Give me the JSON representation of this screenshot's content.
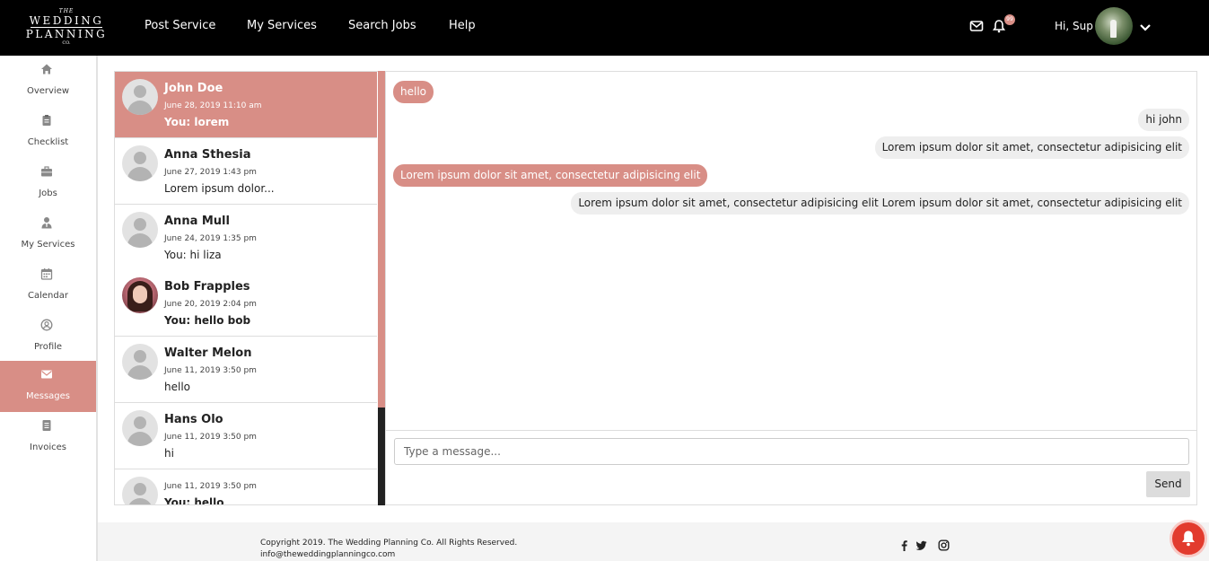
{
  "brand": {
    "the": "THE",
    "line1": "WEDDING",
    "line2": "PLANNING",
    "co": "CO."
  },
  "nav": {
    "links": [
      "Post Service",
      "My Services",
      "Search Jobs",
      "Help"
    ],
    "notification_count": "99",
    "greeting": "Hi, Sup",
    "icons": [
      "envelope-icon",
      "bell-icon",
      "chevron-down-icon"
    ]
  },
  "sidebar": {
    "items": [
      {
        "label": "Overview",
        "icon": "home-icon"
      },
      {
        "label": "Checklist",
        "icon": "clipboard-icon"
      },
      {
        "label": "Jobs",
        "icon": "briefcase-icon"
      },
      {
        "label": "My Services",
        "icon": "user-tie-icon"
      },
      {
        "label": "Calendar",
        "icon": "calendar-icon"
      },
      {
        "label": "Profile",
        "icon": "user-circle-icon"
      },
      {
        "label": "Messages",
        "icon": "envelope-icon"
      },
      {
        "label": "Invoices",
        "icon": "file-icon"
      }
    ],
    "active": "Messages"
  },
  "conversations": [
    {
      "name": "John Doe",
      "date": "June 28, 2019 11:10 am",
      "preview": "You: lorem"
    },
    {
      "name": "Anna Sthesia",
      "date": "June 27, 2019 1:43 pm",
      "preview": "Lorem ipsum dolor..."
    },
    {
      "name": "Anna Mull",
      "date": "June 24, 2019 1:35 pm",
      "preview": "You: hi liza"
    },
    {
      "name": "Bob Frapples",
      "date": "June 20, 2019 2:04 pm",
      "preview": "You: hello bob"
    },
    {
      "name": "Walter Melon",
      "date": "June 11, 2019 3:50 pm",
      "preview": "hello"
    },
    {
      "name": "Hans Olo",
      "date": "June 11, 2019 3:50 pm",
      "preview": "hi"
    },
    {
      "name": "",
      "date": "June 11, 2019 3:50 pm",
      "preview": "You: hello"
    }
  ],
  "chat": {
    "messages": [
      {
        "direction": "in",
        "text": "hello"
      },
      {
        "direction": "out",
        "text": "hi john"
      },
      {
        "direction": "out",
        "text": "Lorem ipsum dolor sit amet, consectetur adipisicing elit"
      },
      {
        "direction": "in",
        "text": "Lorem ipsum dolor sit amet, consectetur adipisicing elit"
      },
      {
        "direction": "out",
        "text": "Lorem ipsum dolor sit amet, consectetur adipisicing elit Lorem ipsum dolor sit amet, consectetur adipisicing elit"
      }
    ],
    "input_placeholder": "Type a message...",
    "send_label": "Send"
  },
  "footer": {
    "copyright": "Copyright 2019. The Wedding Planning Co. All Rights Reserved.",
    "email": "info@theweddingplanningco.com",
    "social_icons": [
      "facebook-icon",
      "twitter-icon",
      "instagram-icon"
    ]
  },
  "colors": {
    "accent": "#d88e86",
    "topbar": "#000000",
    "fab": "#e23b2e"
  }
}
